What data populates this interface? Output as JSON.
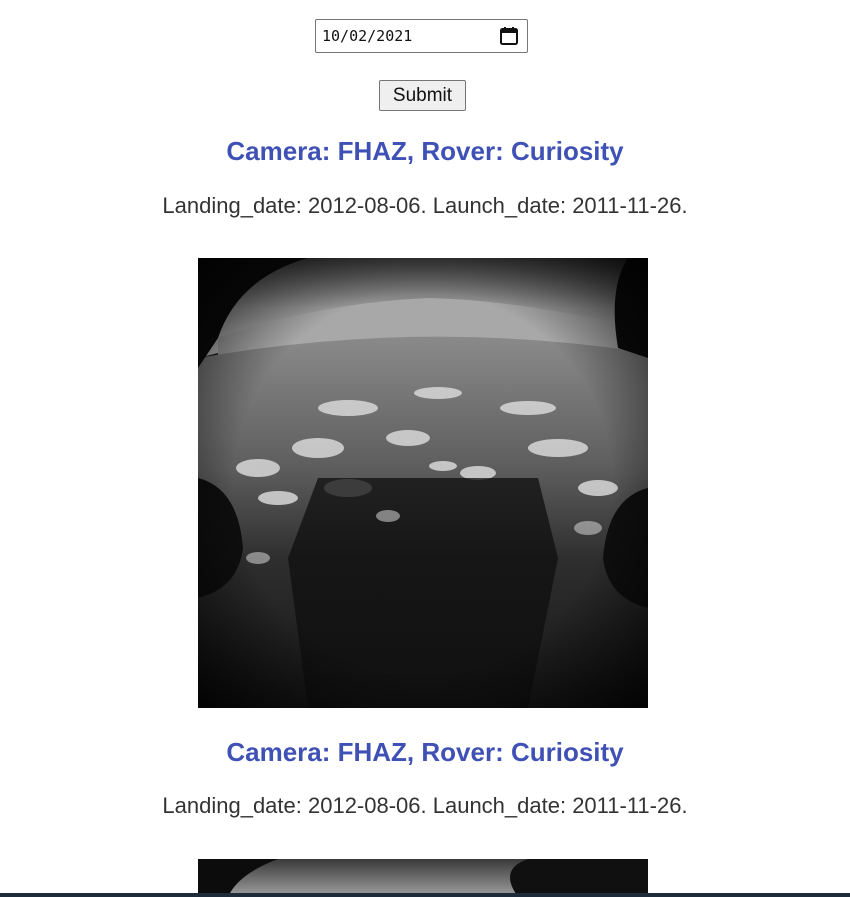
{
  "date_picker": {
    "value": "10/02/2021",
    "icon": "calendar-icon"
  },
  "form": {
    "submit_label": "Submit"
  },
  "photos": [
    {
      "title": "Camera: FHAZ, Rover: Curiosity",
      "dates": "Landing_date: 2012-08-06. Launch_date: 2011-11-26."
    },
    {
      "title": "Camera: FHAZ, Rover: Curiosity",
      "dates": "Landing_date: 2012-08-06. Launch_date: 2011-11-26."
    }
  ],
  "colors": {
    "title": "#3f51b5",
    "text": "#333333",
    "bottom_bar": "#1d2b3a"
  }
}
